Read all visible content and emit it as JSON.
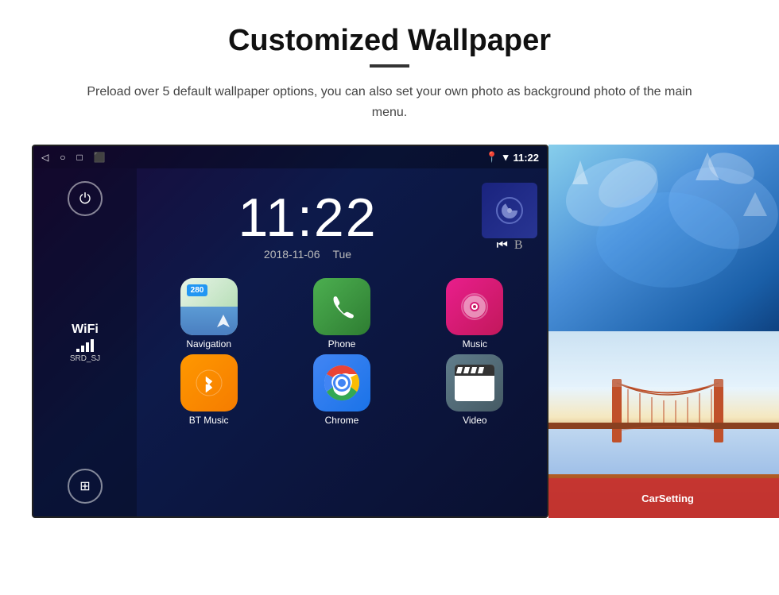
{
  "page": {
    "title": "Customized Wallpaper",
    "subtitle": "Preload over 5 default wallpaper options, you can also set your own photo as background photo of the main menu."
  },
  "android": {
    "time": "11:22",
    "date": "2018-11-06",
    "day": "Tue",
    "wifi_label": "WiFi",
    "wifi_ssid": "SRD_SJ",
    "signal_time": "11:22"
  },
  "apps": [
    {
      "label": "Navigation",
      "id": "nav"
    },
    {
      "label": "Phone",
      "id": "phone"
    },
    {
      "label": "Music",
      "id": "music"
    },
    {
      "label": "BT Music",
      "id": "bt"
    },
    {
      "label": "Chrome",
      "id": "chrome"
    },
    {
      "label": "Video",
      "id": "video"
    }
  ],
  "wallpapers": [
    {
      "label": "Ice/Blue",
      "id": "ice"
    },
    {
      "label": "Bridge/City",
      "id": "city"
    }
  ],
  "carsetting": {
    "label": "CarSetting"
  },
  "nav_badge": "280"
}
